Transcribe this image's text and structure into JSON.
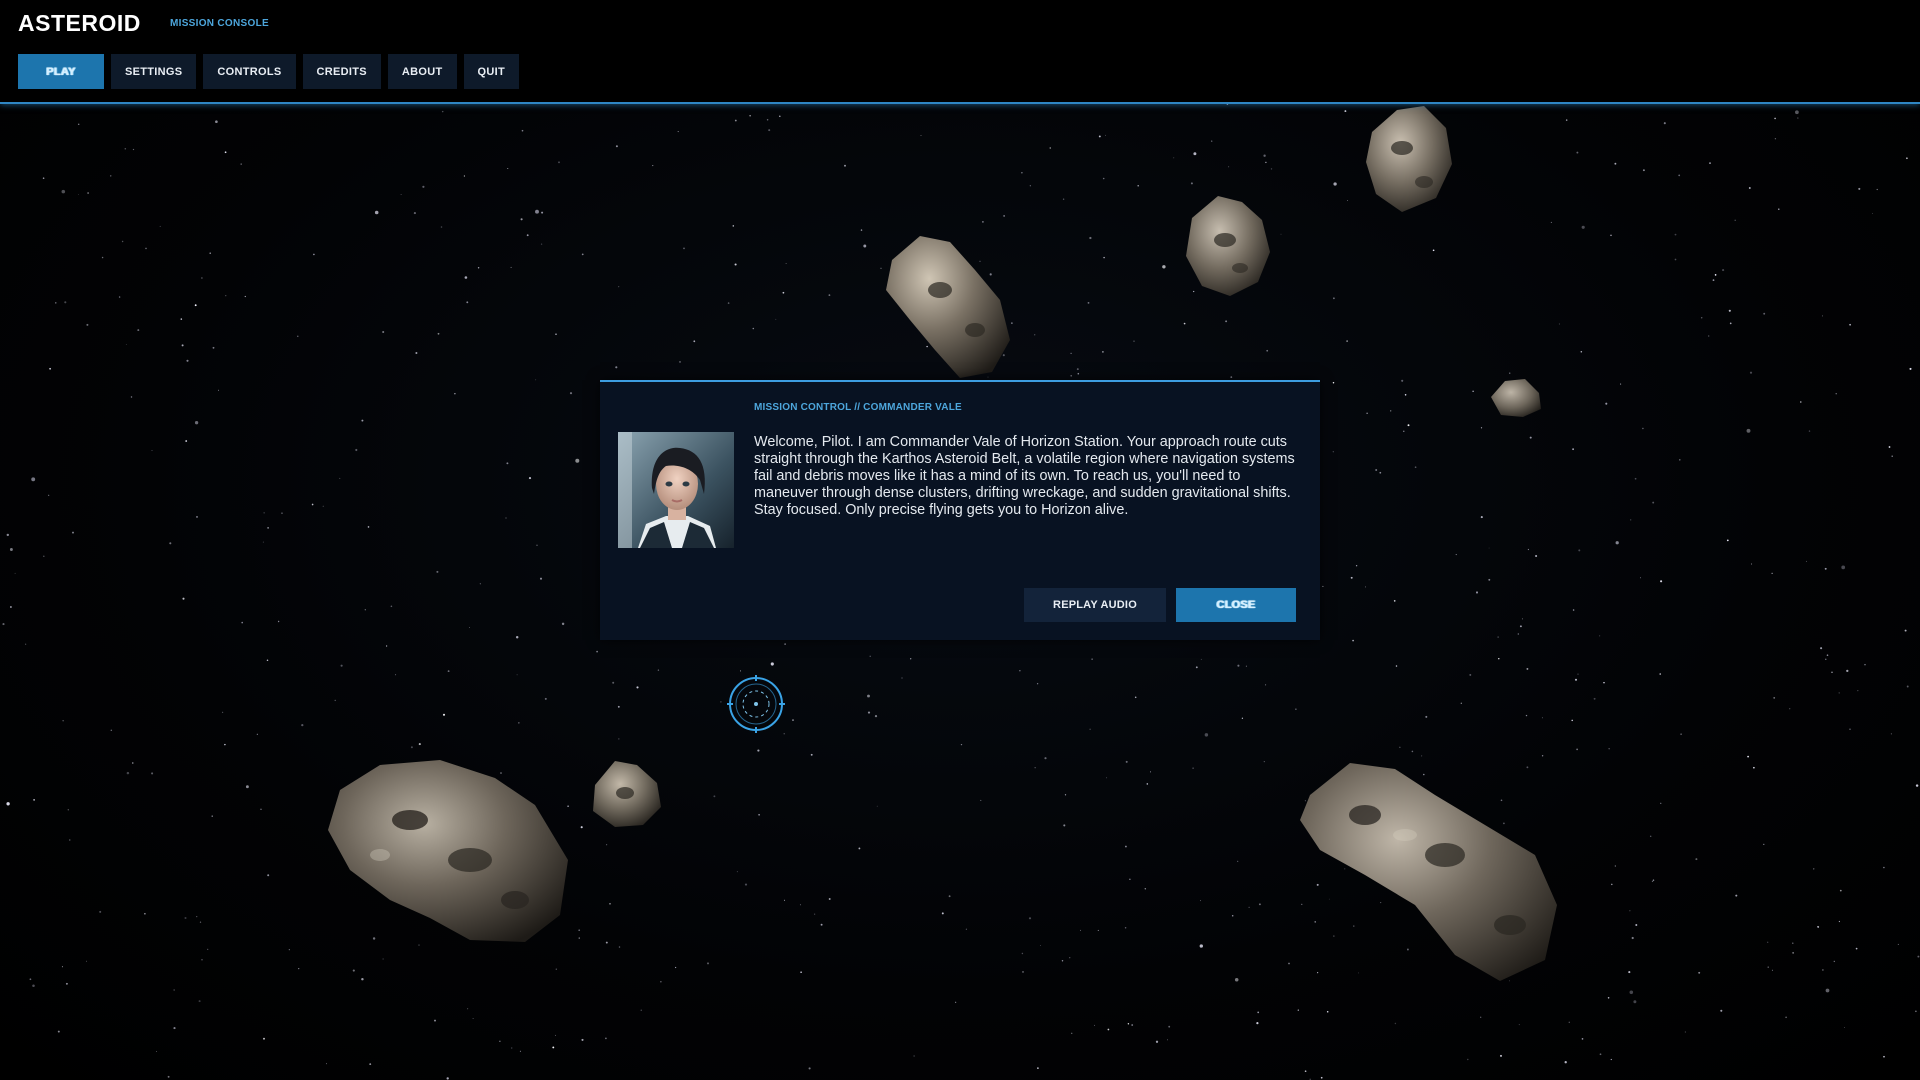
{
  "header": {
    "title": "ASTEROID",
    "subtitle": "MISSION CONSOLE"
  },
  "menu": {
    "items": [
      {
        "label": "PLAY",
        "active": true
      },
      {
        "label": "SETTINGS",
        "active": false
      },
      {
        "label": "CONTROLS",
        "active": false
      },
      {
        "label": "CREDITS",
        "active": false
      },
      {
        "label": "ABOUT",
        "active": false
      },
      {
        "label": "QUIT",
        "active": false
      }
    ]
  },
  "dialog": {
    "speaker": "MISSION CONTROL // COMMANDER VALE",
    "message": "Welcome, Pilot. I am Commander Vale of Horizon Station. Your approach route cuts straight through the Karthos Asteroid Belt, a volatile region where navigation systems fail and debris moves like it has a mind of its own. To reach us, you'll need to maneuver through dense clusters, drifting wreckage, and sudden gravitational shifts. Stay focused. Only precise flying gets you to Horizon alive.",
    "replay_label": "REPLAY AUDIO",
    "close_label": "CLOSE"
  },
  "colors": {
    "accent": "#2f86c4",
    "accent_text": "#4da6dc",
    "active_button": "#1d75ad",
    "button": "#0e1a2a",
    "dialog_bg": "#081222"
  },
  "icons": {
    "reticle": "targeting-reticle-icon"
  }
}
